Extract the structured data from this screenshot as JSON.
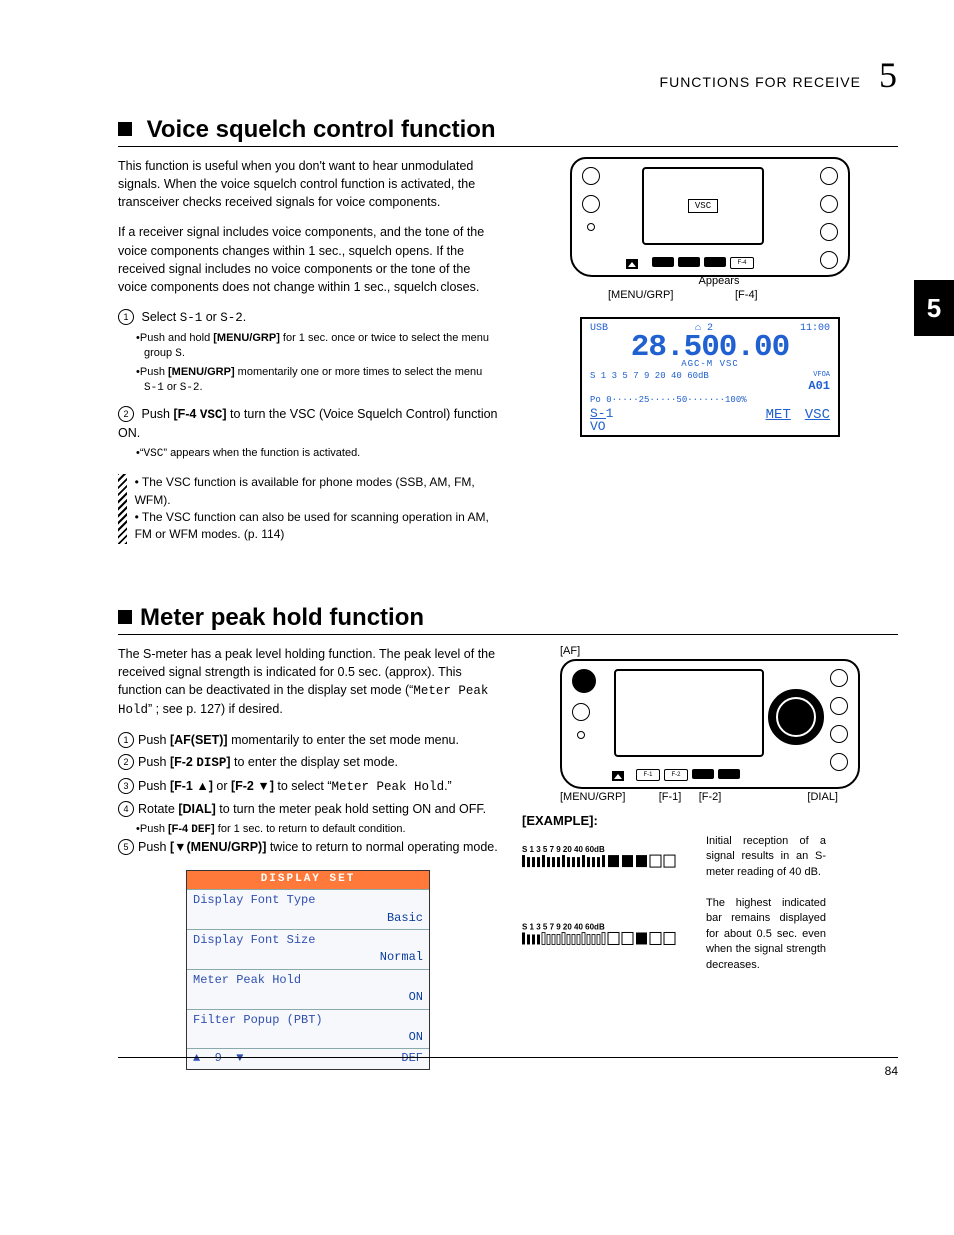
{
  "header": {
    "section_name": "FUNCTIONS FOR RECEIVE",
    "chapter_num": "5"
  },
  "side_tab": "5",
  "page_num": "84",
  "vsc": {
    "title": "Voice squelch control function",
    "intro1": "This function is useful when you don't want to hear unmodulated signals. When the voice squelch control function is activated, the transceiver checks received signals for voice components.",
    "intro2": "If a receiver signal includes voice components, and the tone of the voice components changes within 1 sec., squelch opens. If the received signal includes no voice components or the tone of the voice components does not change within 1 sec., squelch closes.",
    "step1_pre": "Select ",
    "step1_code": "S-1",
    "step1_mid": " or ",
    "step1_code2": "S-2",
    "step1_post": ".",
    "sub1a_a": "Push and hold ",
    "sub1a_b": "[MENU/GRP]",
    "sub1a_c": " for 1 sec. once or twice to select the menu group ",
    "sub1a_d": "S",
    "sub1a_e": ".",
    "sub1b_a": "Push ",
    "sub1b_b": "[MENU/GRP]",
    "sub1b_c": " momentarily one or more times to select the menu ",
    "sub1b_d": "S-1",
    "sub1b_e": " or ",
    "sub1b_f": "S-2",
    "sub1b_g": ".",
    "step2_a": "Push ",
    "step2_b": "[F-4 ",
    "step2_code": "VSC",
    "step2_c": "]",
    "step2_d": " to turn the VSC (Voice Squelch Control) function ON.",
    "sub2_a": "“",
    "sub2_b": "VSC",
    "sub2_c": "” appears when the function is activated.",
    "note1": "The VSC function is available for phone modes (SSB, AM, FM, WFM).",
    "note2": "The VSC function can also be used for scanning operation in AM, FM or WFM modes. (p. 114)",
    "diagram": {
      "vsc_badge": "VSC",
      "appears": "Appears",
      "label_left": "[MENU/GRP]",
      "label_right": "[F-4]"
    },
    "lcd": {
      "mode": "USB",
      "ant": "⌂ 2",
      "time": "11:00",
      "freq": "28.500.00",
      "agc": "AGC-M VSC",
      "vfo": "VFOA",
      "mem": "A01",
      "scale1": "S 1  3  5  7  9 20 40 60dB",
      "scale2": "Po 0·····25·····50·······100%",
      "s1": "S-1",
      "vo": "VO",
      "met": "MET",
      "vsc": "VSC"
    }
  },
  "mph": {
    "title": "Meter peak hold function",
    "intro_a": "The S-meter has a peak level holding function. The peak level of the received signal strength is indicated for 0.5 sec. (approx). This function can be deactivated in the display set mode (“",
    "intro_code": "Meter Peak Hold",
    "intro_b": "” ; see p. 127) if desired.",
    "s1_a": "Push ",
    "s1_b": "[AF(SET)]",
    "s1_c": " momentarily to enter the set mode menu.",
    "s2_a": "Push ",
    "s2_b": "[F-2 ",
    "s2_code": "DISP",
    "s2_c": "]",
    "s2_d": " to enter the display set mode.",
    "s3_a": "Push ",
    "s3_b": "[F-1 ▲]",
    "s3_c": " or ",
    "s3_d": "[F-2 ▼]",
    "s3_e": " to select “",
    "s3_code": "Meter Peak Hold",
    "s3_f": ".”",
    "s4_a": "Rotate ",
    "s4_b": "[DIAL]",
    "s4_c": " to turn the meter peak hold setting ON and OFF.",
    "s4sub_a": "Push ",
    "s4sub_b": "[F-4 ",
    "s4sub_code": "DEF",
    "s4sub_c": "]",
    "s4sub_d": " for 1 sec. to return to default condition.",
    "s5_a": "Push ",
    "s5_b": "[▼(MENU/GRP)]",
    "s5_c": " twice to return to normal operating mode.",
    "diagram": {
      "af": "[AF]",
      "menu": "[MENU/GRP]",
      "f1": "[F-1]",
      "f2": "[F-2]",
      "dial": "[DIAL]"
    },
    "dset": {
      "title": "DISPLAY SET",
      "r1k": "Display Font Type",
      "r1v": "Basic",
      "r2k": "Display Font Size",
      "r2v": "Normal",
      "r3k": "Meter Peak Hold",
      "r3v": "ON",
      "r4k": "Filter Popup (PBT)",
      "r4v": "ON",
      "foot_up": "▲",
      "foot_g": "9",
      "foot_dn": "▼",
      "foot_def": "DEF"
    },
    "example": {
      "heading": "[EXAMPLE]:",
      "scale": "S  1    3    5    7    9   20    40    60dB",
      "txt1": "Initial reception of a signal results in an S-meter reading of 40 dB.",
      "txt2": "The highest indicated bar remains displayed for about 0.5 sec. even when the signal strength decreases."
    }
  }
}
